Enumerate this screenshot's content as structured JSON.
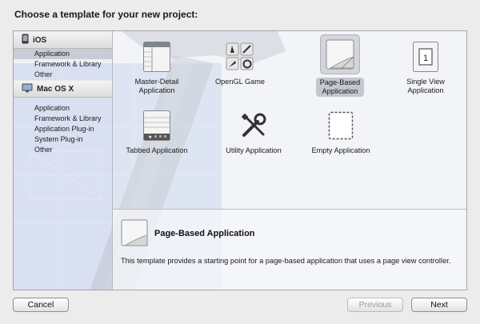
{
  "header": {
    "title": "Choose a template for your new project:"
  },
  "sidebar": {
    "groups": [
      {
        "label": "iOS",
        "icon": "ios-device-icon",
        "items": [
          "Application",
          "Framework & Library",
          "Other"
        ]
      },
      {
        "label": "Mac OS X",
        "icon": "mac-os-x-icon",
        "items": [
          "Application",
          "Framework & Library",
          "Application Plug-in",
          "System Plug-in",
          "Other"
        ]
      }
    ],
    "selected": {
      "group": "iOS",
      "item": "Application"
    }
  },
  "templates": [
    {
      "label": "Master-Detail\nApplication",
      "icon": "master-detail-icon"
    },
    {
      "label": "OpenGL Game",
      "icon": "opengl-game-icon"
    },
    {
      "label": "Page-Based\nApplication",
      "icon": "page-based-icon",
      "selected": true
    },
    {
      "label": "Single View\nApplication",
      "icon": "single-view-icon"
    },
    {
      "label": "Tabbed Application",
      "icon": "tabbed-icon"
    },
    {
      "label": "Utility Application",
      "icon": "utility-icon"
    },
    {
      "label": "Empty Application",
      "icon": "empty-icon"
    }
  ],
  "description": {
    "title": "Page-Based Application",
    "body": "This template provides a starting point for a page-based application that uses a page view controller.",
    "icon": "page-based-icon"
  },
  "buttons": {
    "cancel": "Cancel",
    "previous": "Previous",
    "next": "Next"
  },
  "colors": {
    "sidebar_selected": "#c7ccd6",
    "blueprint": "#3b6fd8"
  },
  "background_image": "hammer-blueprint"
}
